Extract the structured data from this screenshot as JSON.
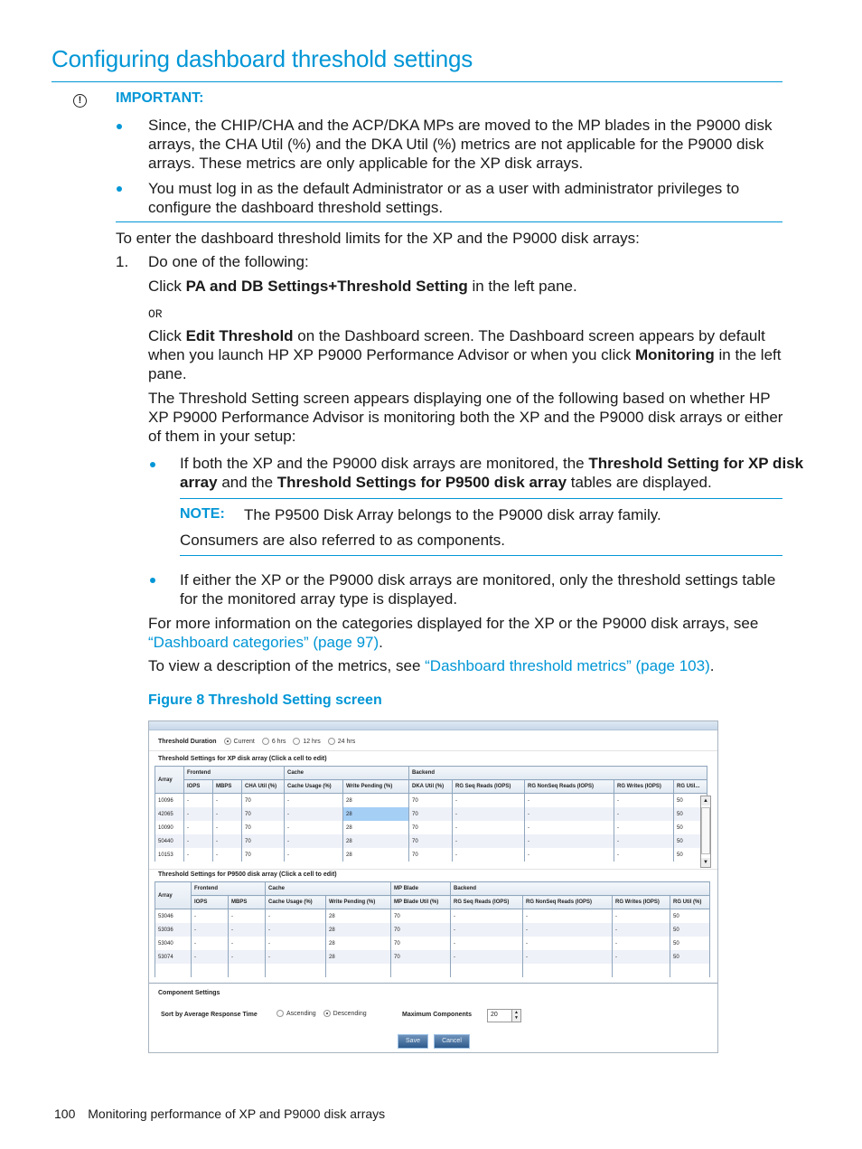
{
  "title": "Configuring dashboard threshold settings",
  "important": {
    "label": "IMPORTANT:",
    "icon": "exclamation-circle-icon",
    "items": [
      [
        "Since, the CHIP/CHA and the ACP/DKA MPs are moved to the MP blades in the P9000 disk",
        "arrays, the CHA Util (%) and the DKA Util (%) metrics are not applicable for the P9000 disk",
        "arrays. These metrics are only applicable for the XP disk arrays."
      ],
      [
        "You must log in as the default Administrator or as a user with administrator privileges to",
        "configure the dashboard threshold settings."
      ]
    ]
  },
  "intro": "To enter the dashboard threshold limits for the XP and the P9000 disk arrays:",
  "step1": {
    "num": "1.",
    "text": "Do one of the following:",
    "opt1": {
      "pre": "Click ",
      "bold": "PA and DB Settings+Threshold Setting",
      "post": " in the left pane."
    },
    "or": "OR",
    "opt2": {
      "pre": "Click ",
      "bold": "Edit Threshold",
      "line1_post": " on the Dashboard screen. The Dashboard screen appears by default",
      "line2_pre": "when you launch HP XP P9000 Performance Advisor or when you click ",
      "line2_bold": "Monitoring",
      "line2_post": " in the left",
      "line3": "pane."
    },
    "para": [
      "The Threshold Setting screen appears displaying one of the following based on whether HP",
      "XP P9000 Performance Advisor is monitoring both the XP and the P9000 disk arrays or either",
      "of them in your setup:"
    ],
    "bullet1": {
      "l1_pre": "If both the XP and the P9000 disk arrays are monitored, the ",
      "l1_bold": "Threshold Setting for XP disk",
      "l2_bold": "array",
      "l2_mid": " and the ",
      "l2_bold2": "Threshold Settings for P9500 disk array",
      "l2_post": " tables are displayed."
    },
    "note": {
      "label": "NOTE:",
      "text": "The P9500 Disk Array belongs to the P9000 disk array family.",
      "text2": "Consumers are also referred to as components."
    },
    "bullet2": [
      "If either the XP or the P9000 disk arrays are monitored, only the threshold settings table",
      "for the monitored array type is displayed."
    ],
    "more1": "For more information on the categories displayed for the XP or the P9000 disk arrays, see",
    "more1_link": "“Dashboard categories” (page 97)",
    "more2_pre": "To view a description of the metrics, see ",
    "more2_link": "“Dashboard threshold metrics” (page 103)",
    "period": "."
  },
  "figure": {
    "caption": "Figure 8 Threshold Setting screen",
    "duration": {
      "label": "Threshold Duration",
      "options": [
        "Current",
        "6 hrs",
        "12 hrs",
        "24 hrs"
      ],
      "selected": "Current"
    },
    "xp_table": {
      "title": "Threshold Settings for XP disk array (Click a cell to edit)",
      "groups": [
        "Array",
        "Frontend",
        "Cache",
        "Backend"
      ],
      "columns": [
        "IOPS",
        "MBPS",
        "CHA Util (%)",
        "Cache Usage (%)",
        "Write Pending (%)",
        "DKA Util (%)",
        "RG Seq Reads (IOPS)",
        "RG NonSeq Reads (IOPS)",
        "RG Writes (IOPS)",
        "RG Util..."
      ],
      "rows": [
        [
          "10096",
          "-",
          "-",
          "70",
          "-",
          "28",
          "70",
          "-",
          "-",
          "-",
          "50"
        ],
        [
          "42065",
          "-",
          "-",
          "70",
          "-",
          "28",
          "70",
          "-",
          "-",
          "-",
          "50"
        ],
        [
          "10090",
          "-",
          "-",
          "70",
          "-",
          "28",
          "70",
          "-",
          "-",
          "-",
          "50"
        ],
        [
          "50440",
          "-",
          "-",
          "70",
          "-",
          "28",
          "70",
          "-",
          "-",
          "-",
          "50"
        ],
        [
          "10153",
          "-",
          "-",
          "70",
          "-",
          "28",
          "70",
          "-",
          "-",
          "-",
          "50"
        ]
      ]
    },
    "p9500_table": {
      "title": "Threshold Settings for P9500 disk array (Click a cell to edit)",
      "groups": [
        "Array",
        "Frontend",
        "Cache",
        "MP Blade",
        "Backend"
      ],
      "columns": [
        "IOPS",
        "MBPS",
        "Cache Usage (%)",
        "Write Pending (%)",
        "MP Blade Util (%)",
        "RG Seq Reads (IOPS)",
        "RG NonSeq Reads (IOPS)",
        "RG Writes (IOPS)",
        "RG Util (%)"
      ],
      "rows": [
        [
          "53046",
          "-",
          "-",
          "-",
          "28",
          "70",
          "-",
          "-",
          "-",
          "50"
        ],
        [
          "53036",
          "-",
          "-",
          "-",
          "28",
          "70",
          "-",
          "-",
          "-",
          "50"
        ],
        [
          "53040",
          "-",
          "-",
          "-",
          "28",
          "70",
          "-",
          "-",
          "-",
          "50"
        ],
        [
          "53074",
          "-",
          "-",
          "-",
          "28",
          "70",
          "-",
          "-",
          "-",
          "50"
        ]
      ]
    },
    "component_settings": {
      "title": "Component Settings",
      "sort_label": "Sort by Average Response Time",
      "sort_options": [
        "Ascending",
        "Descending"
      ],
      "sort_selected": "Descending",
      "max_label": "Maximum Components",
      "max_value": "20"
    },
    "buttons": {
      "save": "Save",
      "cancel": "Cancel"
    }
  },
  "footer": {
    "page": "100",
    "section": "Monitoring performance of XP and P9000 disk arrays"
  }
}
